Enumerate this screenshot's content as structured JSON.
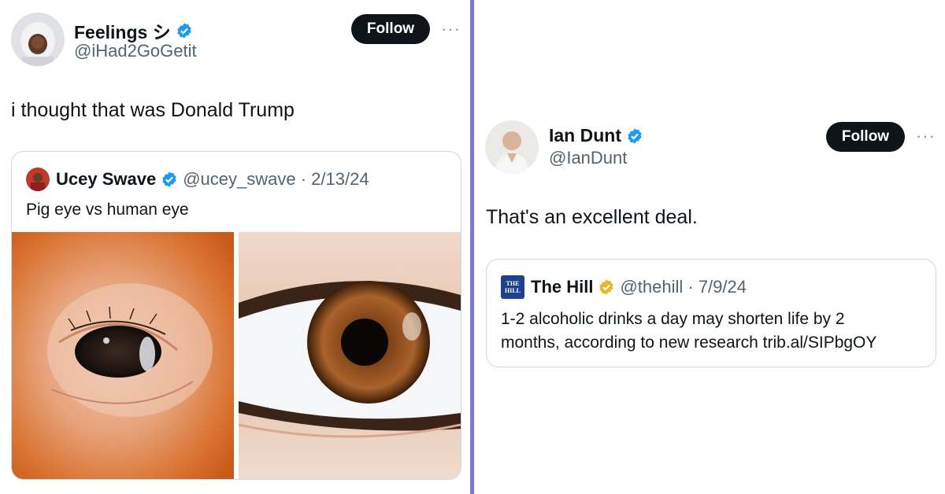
{
  "left_tweet": {
    "author_name": "Feelings シ",
    "author_handle": "@iHad2GoGetit",
    "follow_label": "Follow",
    "more_label": "···",
    "text": "i thought that was Donald Trump",
    "quote": {
      "author_name": "Ucey Swave",
      "author_meta": "@ucey_swave · 2/13/24",
      "text": "Pig eye vs human eye",
      "images": [
        "pig-eye-photo",
        "human-eye-photo"
      ]
    }
  },
  "right_tweet": {
    "author_name": "Ian Dunt",
    "author_handle": "@IanDunt",
    "follow_label": "Follow",
    "more_label": "···",
    "text": "That's an excellent deal.",
    "quote": {
      "author_name": "The Hill",
      "author_meta": "@thehill · 7/9/24",
      "text_line1": "1-2 alcoholic drinks a day may shorten life by 2",
      "text_line2": "months, according to new research trib.al/SIPbgOY",
      "logo_text": "THE HILL"
    }
  },
  "colors": {
    "verified_blue": "#1d9bf0",
    "verified_gold": "#e8b829",
    "divider": "#7b78e0"
  }
}
